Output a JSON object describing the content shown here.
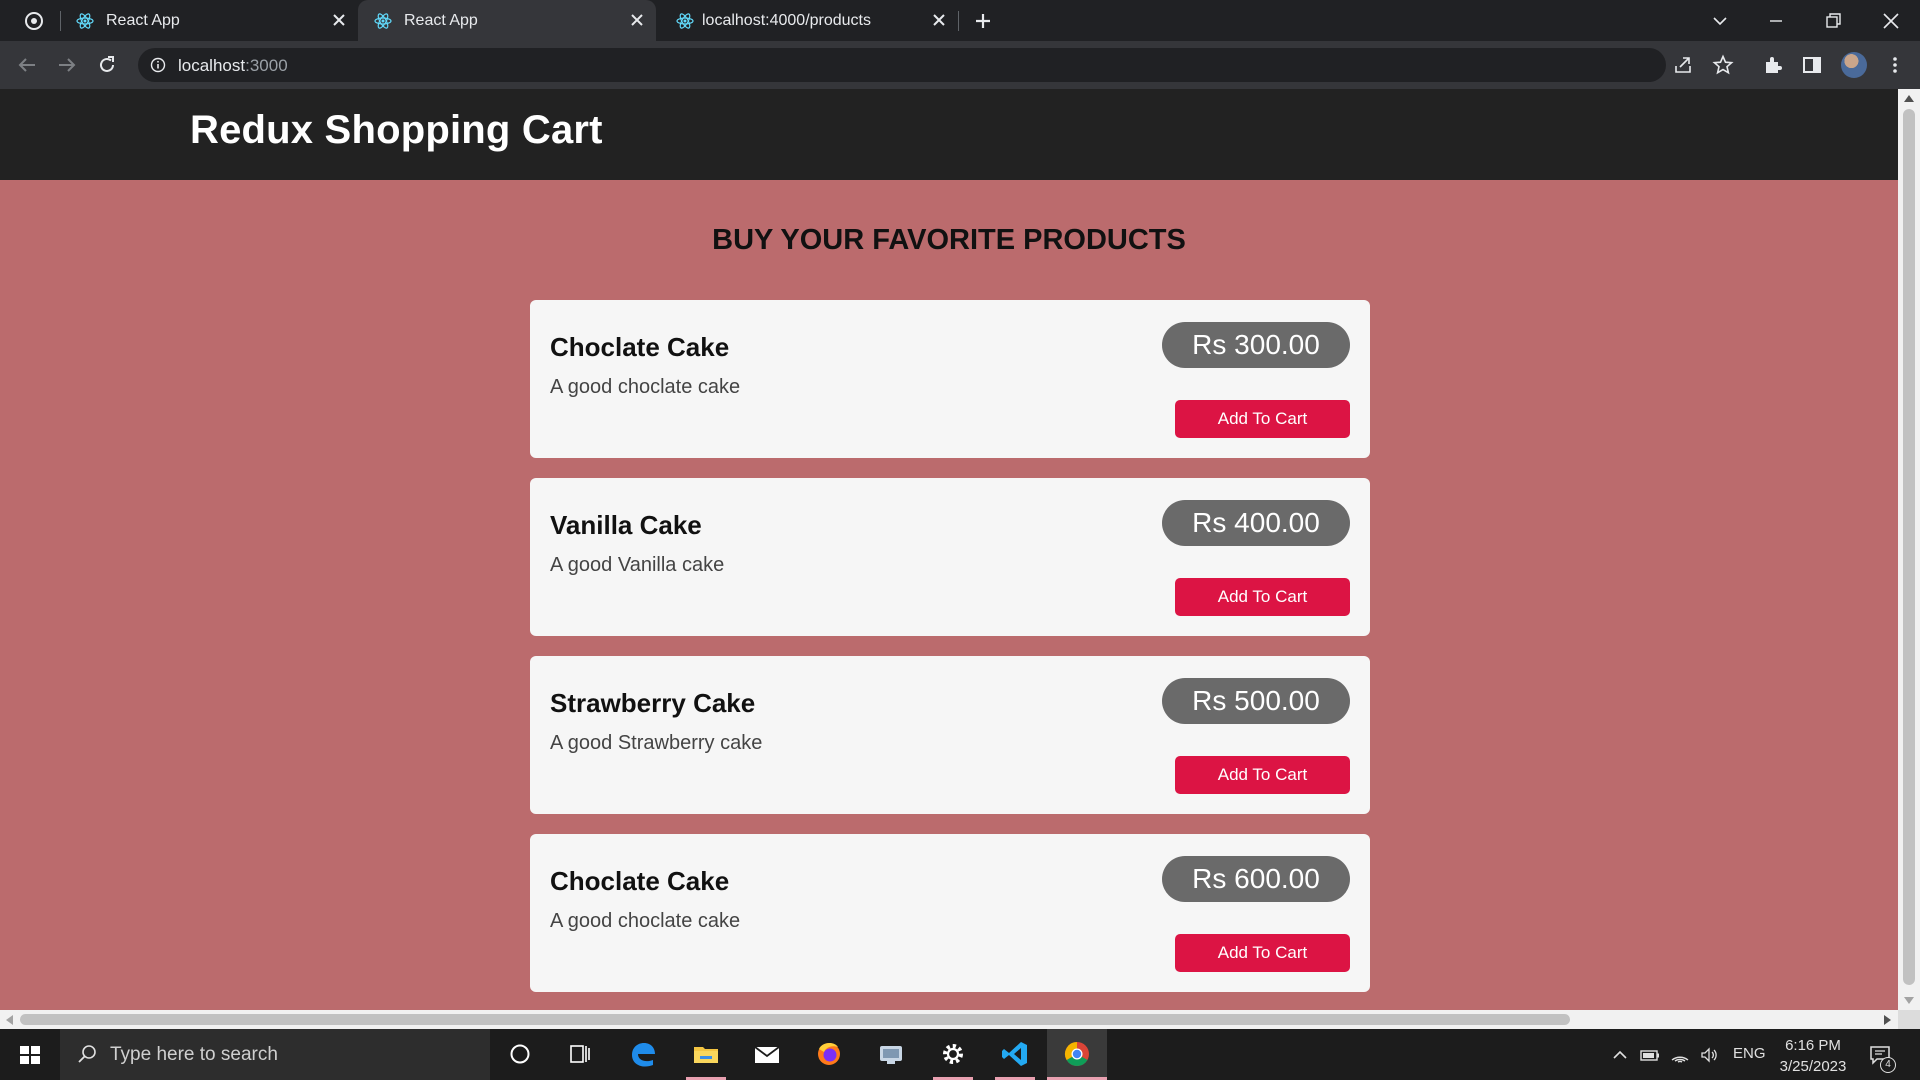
{
  "browser": {
    "tabs": [
      {
        "title": "React App",
        "favicon": "react-icon",
        "active": false
      },
      {
        "title": "React App",
        "favicon": "react-icon",
        "active": true
      },
      {
        "title": "localhost:4000/products",
        "favicon": "react-icon",
        "active": false
      }
    ],
    "url_host": "localhost",
    "url_port": ":3000"
  },
  "app": {
    "header_title": "Redux Shopping Cart",
    "page_heading": "BUY YOUR FAVORITE PRODUCTS",
    "add_to_cart_label": "Add To Cart",
    "products": [
      {
        "name": "Choclate Cake",
        "description": "A good choclate cake",
        "price": "Rs 300.00"
      },
      {
        "name": "Vanilla Cake",
        "description": "A good Vanilla cake",
        "price": "Rs 400.00"
      },
      {
        "name": "Strawberry Cake",
        "description": "A good Strawberry cake",
        "price": "Rs 500.00"
      },
      {
        "name": "Choclate Cake",
        "description": "A good choclate cake",
        "price": "Rs 600.00"
      }
    ]
  },
  "taskbar": {
    "search_placeholder": "Type here to search",
    "language": "ENG",
    "time": "6:16 PM",
    "date": "3/25/2023",
    "notification_count": "4"
  },
  "colors": {
    "page_background": "#bb6b6d",
    "header_background": "#222222",
    "price_pill": "#6a6a6a",
    "add_button": "#dc1444"
  }
}
